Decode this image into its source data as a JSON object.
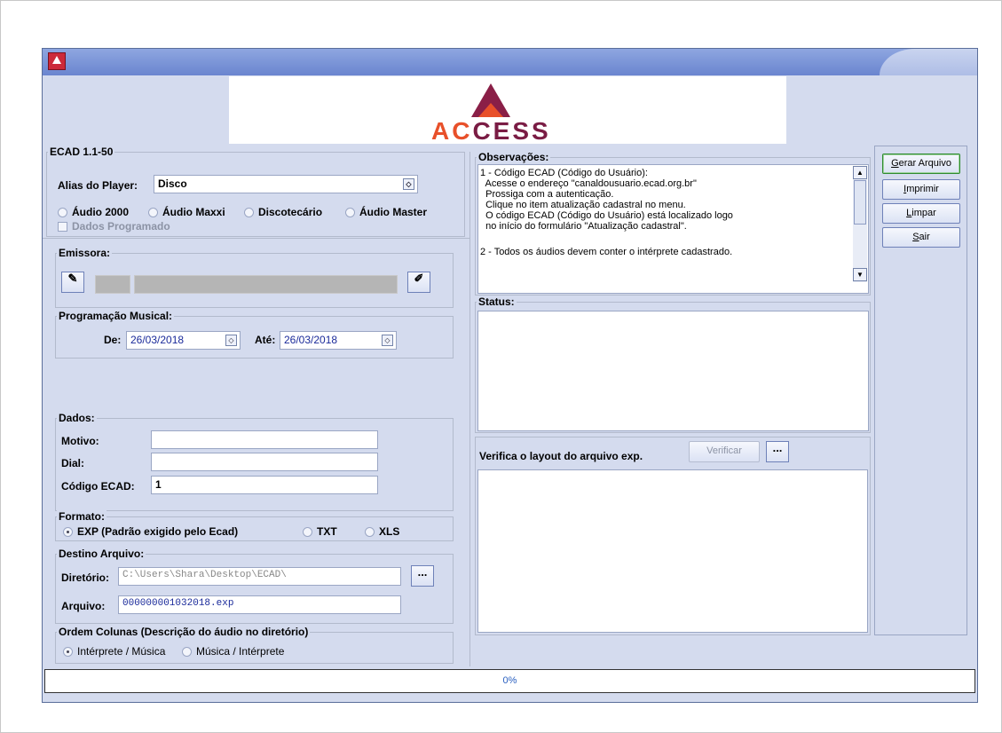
{
  "window": {
    "title": ""
  },
  "logo": {
    "text_part1": "AC",
    "text_part2": "CESS"
  },
  "ecad_group": {
    "title": "ECAD 1.1-50",
    "alias_label": "Alias do Player:",
    "alias_value": "Disco",
    "radios": [
      "Áudio 2000",
      "Áudio Maxxi",
      "Discotecário",
      "Áudio Master"
    ],
    "checkbox_label": "Dados Programado"
  },
  "emissora": {
    "title": "Emissora:"
  },
  "programacao": {
    "title": "Programação Musical:",
    "de_label": "De:",
    "de_value": "26/03/2018",
    "ate_label": "Até:",
    "ate_value": "26/03/2018"
  },
  "dados": {
    "title": "Dados:",
    "motivo_label": "Motivo:",
    "motivo_value": "",
    "dial_label": "Dial:",
    "dial_value": "",
    "codigo_label": "Código ECAD:",
    "codigo_value": "1"
  },
  "formato": {
    "title": "Formato:",
    "options": [
      "EXP (Padrão exigido pelo Ecad)",
      "TXT",
      "XLS"
    ],
    "selected": "EXP (Padrão exigido pelo Ecad)"
  },
  "destino": {
    "title": "Destino Arquivo:",
    "diretorio_label": "Diretório:",
    "diretorio_value": "C:\\Users\\Shara\\Desktop\\ECAD\\",
    "arquivo_label": "Arquivo:",
    "arquivo_value": "000000001032018.exp",
    "browse_label": "..."
  },
  "ordem": {
    "title": "Ordem Colunas (Descrição do áudio no diretório)",
    "options": [
      "Intérprete / Música",
      "Música / Intérprete"
    ],
    "selected": "Intérprete / Música"
  },
  "observacoes": {
    "title": "Observações:",
    "lines": [
      "1 - Código ECAD (Código do Usuário):",
      "  Acesse o endereço \"canaldousuario.ecad.org.br\"",
      "  Prossiga com a autenticação.",
      "  Clique no item atualização cadastral no menu.",
      "  O código ECAD (Código do Usuário) está localizado logo",
      "  no início do formulário \"Atualização cadastral\".",
      "",
      "2 - Todos os áudios devem conter o intérprete cadastrado."
    ]
  },
  "status": {
    "title": "Status:",
    "text": ""
  },
  "verifica": {
    "label": "Verifica o layout do arquivo exp.",
    "button": "Verificar",
    "browse_label": "..."
  },
  "buttons": {
    "gerar": {
      "first": "G",
      "rest": "erar Arquivo"
    },
    "imprimir": {
      "first": "I",
      "rest": "mprimir"
    },
    "limpar": {
      "first": "L",
      "rest": "impar"
    },
    "sair": {
      "first": "S",
      "rest": "air"
    }
  },
  "progress": {
    "text": "0%",
    "value": 0
  },
  "colors": {
    "accent": "#6a85cf",
    "brand": "#8a1f47",
    "brand_orange": "#e8502a"
  }
}
